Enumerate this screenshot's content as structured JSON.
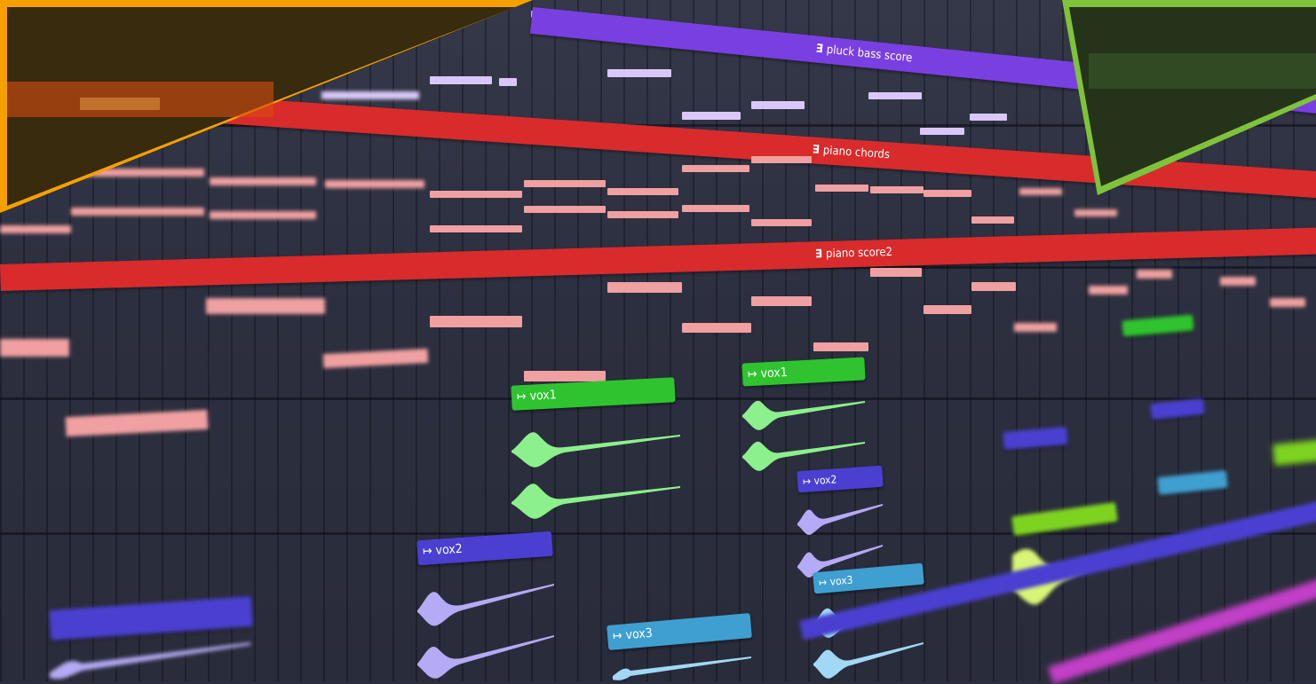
{
  "tracks": {
    "pluck_bass": {
      "label": "pluck bass score",
      "color": "#7a3fe0"
    },
    "piano_chords": {
      "label": "piano chords",
      "color": "#d92b2b"
    },
    "piano_score2": {
      "label": "piano score2",
      "color": "#d92b2b"
    }
  },
  "clips": {
    "vox1_a": {
      "label": "vox1",
      "color": "#2fc42f"
    },
    "vox1_b": {
      "label": "vox1",
      "color": "#2fc42f"
    },
    "vox2_a": {
      "label": "vox2",
      "color": "#4a3fd0"
    },
    "vox2_b": {
      "label": "vox2",
      "color": "#4a3fd0"
    },
    "vox3_a": {
      "label": "vox3",
      "color": "#3f9fd0"
    },
    "vox3_b": {
      "label": "vox3",
      "color": "#3f9fd0"
    }
  },
  "colors": {
    "piano_note": "#f0a0a0",
    "bass_note": "#d9c8f7",
    "vox1_wave": "#8cf08c",
    "vox2_wave": "#b4aaf5",
    "vox3_wave": "#a0d8f5",
    "accent_orange": "#f5a000",
    "accent_green": "#7ec33a"
  }
}
